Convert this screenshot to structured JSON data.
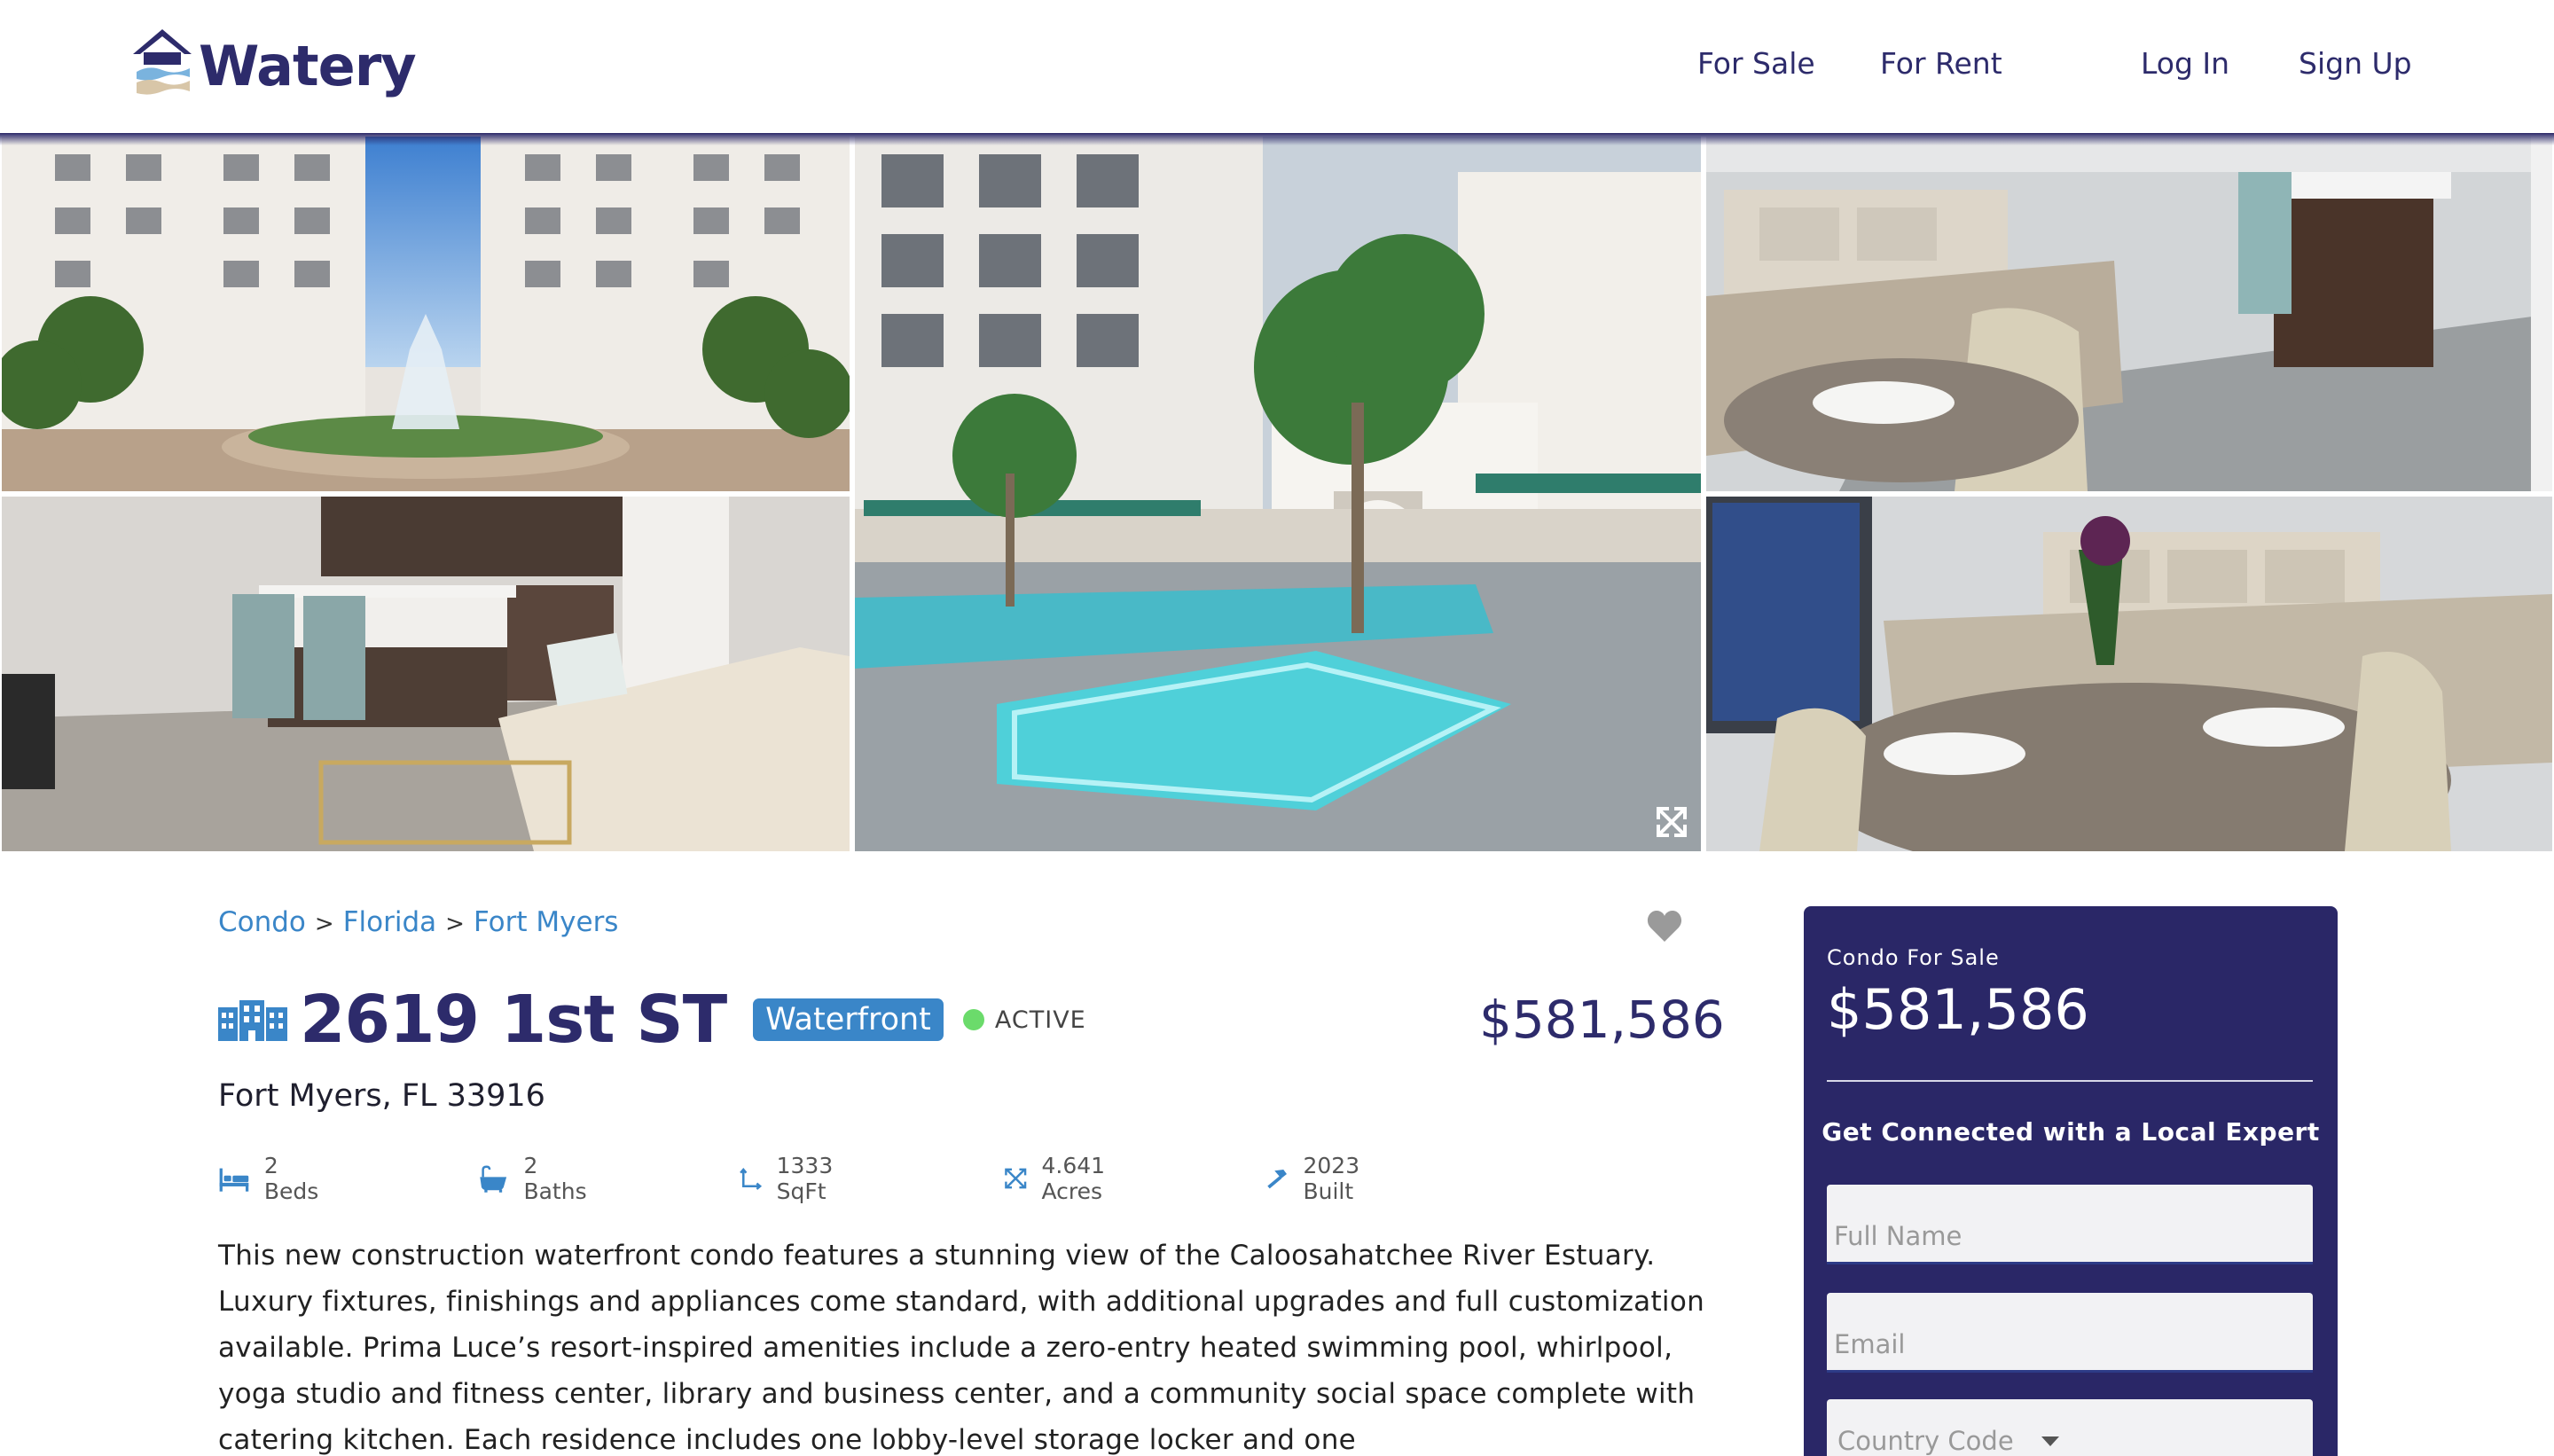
{
  "header": {
    "brand": "Watery",
    "nav": {
      "for_sale": "For Sale",
      "for_rent": "For Rent",
      "log_in": "Log In",
      "sign_up": "Sign Up"
    }
  },
  "breadcrumb": {
    "items": [
      "Condo",
      "Florida",
      "Fort Myers"
    ],
    "separator": ">"
  },
  "listing": {
    "title": "2619 1st ST",
    "badge": "Waterfront",
    "status": "ACTIVE",
    "price": "$581,586",
    "address": "Fort Myers, FL 33916",
    "facts": {
      "beds": "2 Beds",
      "baths": "2 Baths",
      "sqft": "1333 SqFt",
      "acres": "4.641 Acres",
      "built": "2023 Built"
    },
    "description": "This new construction waterfront condo features a stunning view of the Caloosahatchee River Estuary. Luxury fixtures, finishings and appliances come standard, with additional upgrades and full customization available. Prima Luce’s resort-inspired amenities include a zero-entry heated swimming pool, whirlpool, yoga studio and fitness center, library and business center, and a community social space complete with catering kitchen. Each residence includes one lobby-level storage locker and one"
  },
  "contact_card": {
    "subtitle": "Condo For Sale",
    "price": "$581,586",
    "cta": "Get Connected with a Local Expert",
    "full_name_placeholder": "Full Name",
    "email_placeholder": "Email",
    "country_code_placeholder": "Country Code"
  },
  "colors": {
    "brand_navy": "#2a2767",
    "link_blue": "#3a86c8",
    "status_green": "#6bdb6b"
  },
  "icons": {
    "logo": "house-waves-icon",
    "favorite": "heart-icon",
    "expand": "expand-icon",
    "building": "building-icon",
    "beds": "bed-icon",
    "baths": "bathtub-icon",
    "sqft": "area-icon",
    "acres": "arrows-out-icon",
    "built": "hammer-icon"
  }
}
